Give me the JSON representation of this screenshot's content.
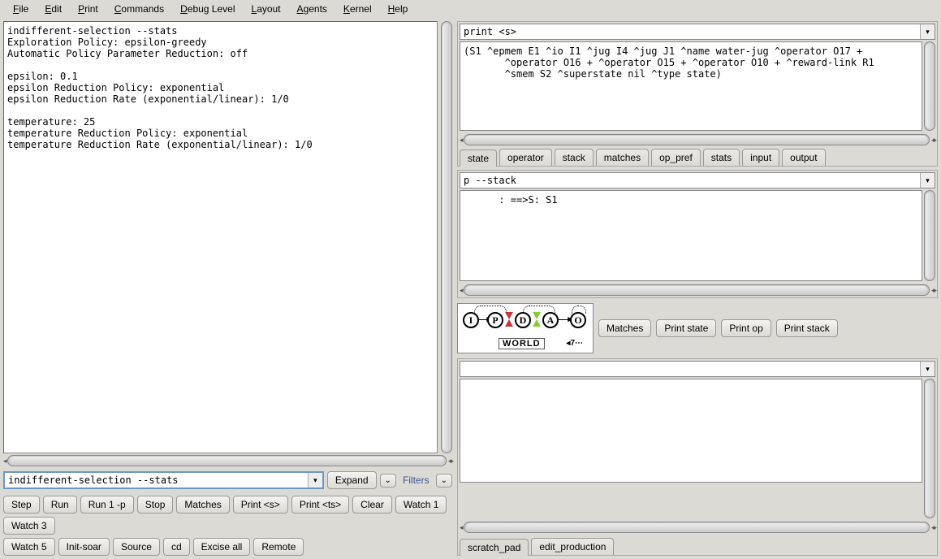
{
  "menu": {
    "file": "File",
    "edit": "Edit",
    "print": "Print",
    "commands": "Commands",
    "debug": "Debug Level",
    "layout": "Layout",
    "agents": "Agents",
    "kernel": "Kernel",
    "help": "Help"
  },
  "console": {
    "output": "indifferent-selection --stats\nExploration Policy: epsilon-greedy\nAutomatic Policy Parameter Reduction: off\n\nepsilon: 0.1\nepsilon Reduction Policy: exponential\nepsilon Reduction Rate (exponential/linear): 1/0\n\ntemperature: 25\ntemperature Reduction Policy: exponential\ntemperature Reduction Rate (exponential/linear): 1/0",
    "input": "indifferent-selection --stats",
    "expand": "Expand",
    "filters": "Filters"
  },
  "buttons": {
    "step": "Step",
    "run": "Run",
    "run1p": "Run 1 -p",
    "stop": "Stop",
    "matches": "Matches",
    "prints": "Print <s>",
    "printts": "Print <ts>",
    "clear": "Clear",
    "watch1": "Watch 1",
    "watch3": "Watch 3",
    "watch5": "Watch 5",
    "initsoar": "Init-soar",
    "source": "Source",
    "cd": "cd",
    "exciseall": "Excise all",
    "remote": "Remote"
  },
  "panel1": {
    "select": "print <s>",
    "output": "(S1 ^epmem E1 ^io I1 ^jug I4 ^jug J1 ^name water-jug ^operator O17 +\n       ^operator O16 + ^operator O15 + ^operator O10 + ^reward-link R1\n       ^smem S2 ^superstate nil ^type state)",
    "tabs": {
      "state": "state",
      "operator": "operator",
      "stack": "stack",
      "matches": "matches",
      "op_pref": "op_pref",
      "stats": "stats",
      "input": "input",
      "output": "output"
    }
  },
  "panel2": {
    "select": "p --stack",
    "output": "      : ==>S: S1"
  },
  "diagram": {
    "i": "I",
    "p": "P",
    "d": "D",
    "a": "A",
    "o": "O",
    "world": "WORLD",
    "seven": "7",
    "btn_matches": "Matches",
    "btn_printstate": "Print state",
    "btn_printop": "Print op",
    "btn_printstack": "Print stack"
  },
  "panel3": {
    "select": ""
  },
  "bottom_tabs": {
    "scratch": "scratch_pad",
    "edit": "edit_production"
  }
}
